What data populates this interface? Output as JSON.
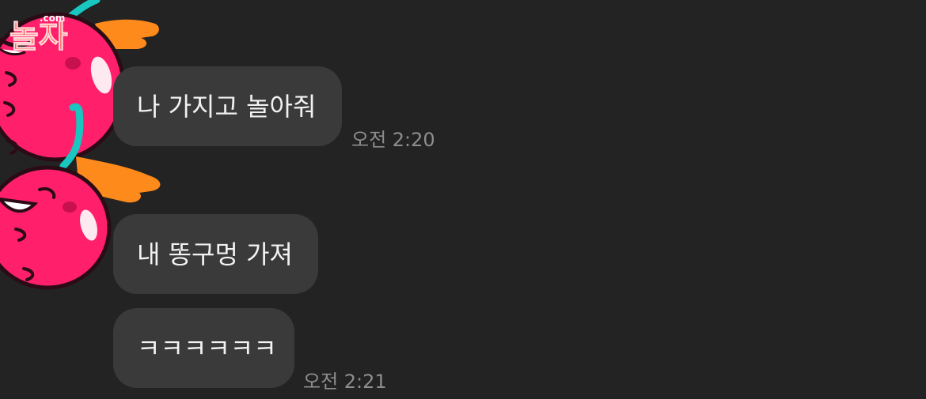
{
  "logo": {
    "text": "놀자",
    "domain": ".com"
  },
  "messages": [
    {
      "text": "나 가지고 놀아줘",
      "time": "오전 2:20"
    },
    {
      "text": "내 똥구멍 가져"
    },
    {
      "text": "ㅋㅋㅋㅋㅋㅋ",
      "time": "오전 2:21"
    }
  ],
  "colors": {
    "background": "#232323",
    "bubble": "#3a3a3a",
    "bubble_text": "#f2f2f2",
    "timestamp": "#8e8e8e",
    "cherry": "#ff1f6b",
    "stem": "#19c6c0",
    "hand": "#ff8a1c"
  }
}
